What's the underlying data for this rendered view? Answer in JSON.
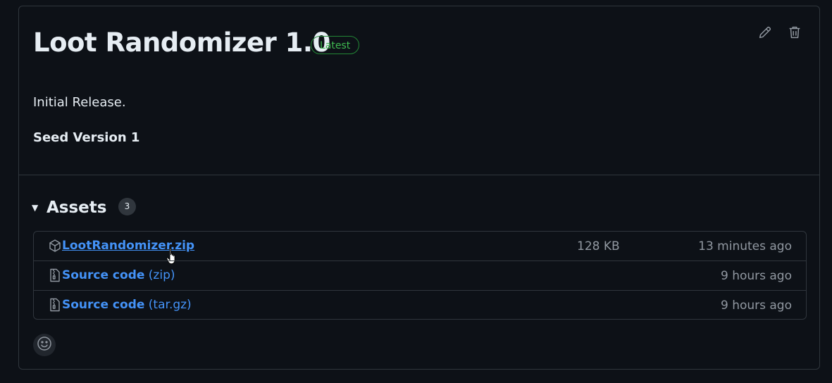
{
  "release": {
    "title": "Loot Randomizer 1.0",
    "badge": "Latest",
    "body": [
      "Initial Release.",
      "Seed Version 1"
    ]
  },
  "actions": {
    "edit_icon": "pencil-icon",
    "delete_icon": "trash-icon"
  },
  "assets": {
    "heading": "Assets",
    "count": "3",
    "items": [
      {
        "name": "LootRandomizer.zip",
        "size": "128 KB",
        "time": "13 minutes ago",
        "icon": "package-icon"
      },
      {
        "name": "Source code",
        "suffix": "(zip)",
        "time": "9 hours ago",
        "icon": "file-zip-icon"
      },
      {
        "name": "Source code",
        "suffix": "(tar.gz)",
        "time": "9 hours ago",
        "icon": "file-zip-icon"
      }
    ]
  },
  "reaction": {
    "icon": "smiley-icon"
  },
  "colors": {
    "background": "#0d1117",
    "border": "#30363d",
    "link": "#4493f8",
    "badge": "#3fb950",
    "muted": "#9198a1"
  }
}
